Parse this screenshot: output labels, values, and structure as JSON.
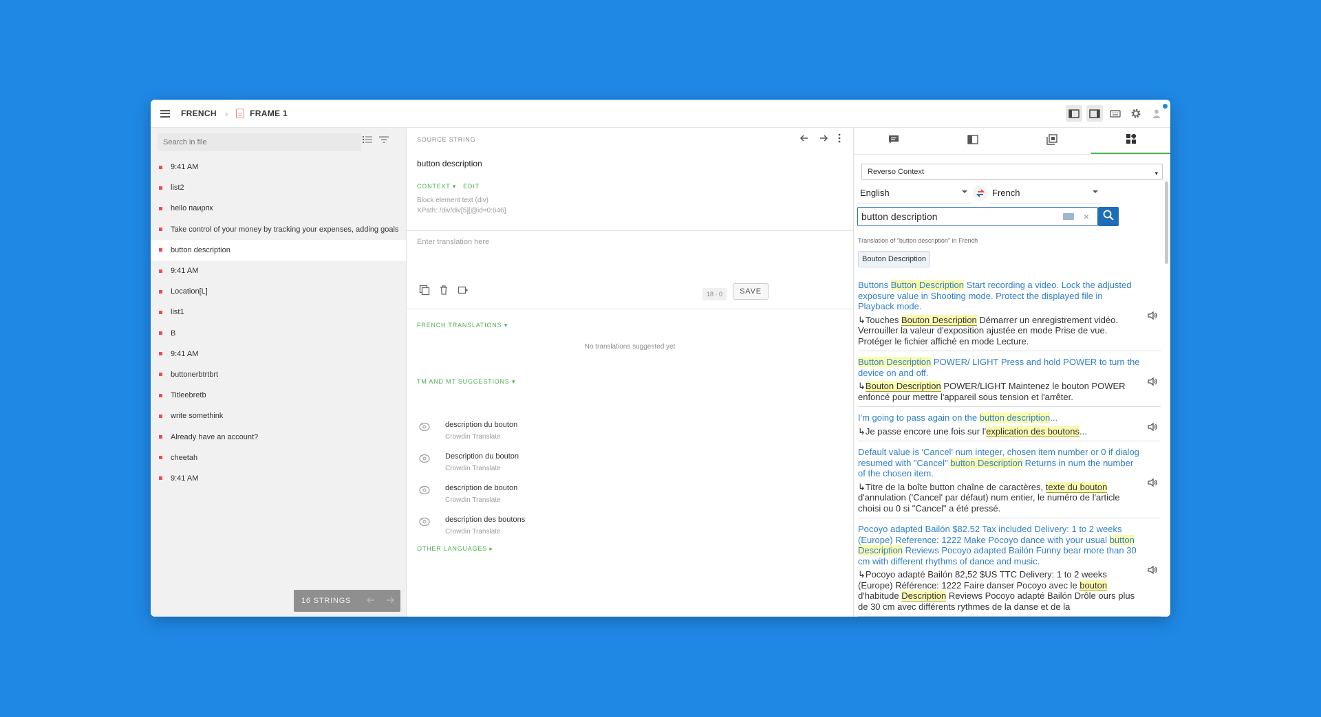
{
  "breadcrumb": {
    "project": "FRENCH",
    "file": "FRAME 1"
  },
  "toolbar": {
    "icons": [
      "sidebar-left-icon",
      "sidebar-right-icon",
      "keyboard-icon",
      "gear-icon",
      "user-icon"
    ]
  },
  "left_panel": {
    "search_placeholder": "Search in file",
    "strings": [
      "9:41 AM",
      "list2",
      "hello паирпк",
      "Take control of your money by tracking your expenses, adding goals",
      "button description",
      "9:41 AM",
      "Location[L]",
      "list1",
      "B",
      "9:41 AM",
      "buttonerbtrtbrt",
      "Titleebretb",
      "write somethink",
      "Already have an account?",
      "cheetah",
      "9:41 AM"
    ],
    "selected_index": 4,
    "count_label": "16 STRINGS"
  },
  "center_panel": {
    "source_label": "SOURCE STRING",
    "source_text": "button description",
    "context_label": "CONTEXT",
    "edit_label": "EDIT",
    "context_line1": "Block element text (div)",
    "context_line2": "XPath: /div/div[5][@id=0:646]",
    "translation_placeholder": "Enter translation here",
    "char_count": "18 · 0",
    "save_label": "SAVE",
    "french_translations_label": "FRENCH TRANSLATIONS",
    "no_translations": "No translations suggested yet",
    "tm_label": "TM AND MT SUGGESTIONS",
    "suggestions": [
      {
        "text": "description du bouton",
        "source": "Crowdin Translate"
      },
      {
        "text": "Description du bouton",
        "source": "Crowdin Translate"
      },
      {
        "text": "description de bouton",
        "source": "Crowdin Translate"
      },
      {
        "text": "description des boutons",
        "source": "Crowdin Translate"
      }
    ],
    "other_languages_label": "OTHER LANGUAGES"
  },
  "right_panel": {
    "tabs": [
      "comments-icon",
      "glossary-icon",
      "memory-icon",
      "apps-icon"
    ],
    "active_tab": 3,
    "provider": "Reverso Context",
    "source_lang": "English",
    "target_lang": "French",
    "query": "button description",
    "translation_of": "Translation of \"button description\" in French",
    "top_translation": "Bouton Description",
    "examples": [
      {
        "en": [
          "Buttons ",
          "Button Description",
          " Start recording a video. Lock the adjusted exposure value in Shooting mode. Protect the displayed file in Playback mode."
        ],
        "fr": [
          "↳Touches ",
          "Bouton Description",
          " Démarrer un enregistrement vidéo. Verrouiller la valeur d'exposition ajustée en mode Prise de vue. Protéger le fichier affiché en mode Lecture."
        ]
      },
      {
        "en": [
          "",
          "Button Description",
          " POWER/ LIGHT Press and hold POWER to turn the device on and off."
        ],
        "fr": [
          "↳",
          "Bouton Description",
          " POWER/LIGHT Maintenez le bouton POWER enfoncé pour mettre l'appareil sous tension et l'arrêter."
        ]
      },
      {
        "en": [
          "I'm going to pass again on the ",
          "button description",
          "..."
        ],
        "fr": [
          "↳Je passe encore une fois sur l'",
          "explication des boutons",
          "..."
        ]
      },
      {
        "en": [
          "Default value is 'Cancel' num integer, chosen item number or 0 if dialog resumed with \"Cancel\" ",
          "button Description",
          " Returns in num the number of the chosen item."
        ],
        "fr": [
          "↳Titre de la boîte button chaîne de caractères, ",
          "texte du bouton",
          " d'annulation ('Cancel' par défaut) num entier, le numéro de l'article choisi ou 0 si \"Cancel\" a été pressé."
        ]
      },
      {
        "en": [
          "Pocoyo adapted Bailón $82.52 Tax included Delivery: 1 to 2 weeks (Europe) Reference: 1222 Make Pocoyo dance with your usual ",
          "button Description",
          " Reviews Pocoyo adapted Bailón Funny bear more than 30 cm with different rhythms of dance and music."
        ],
        "fr": [
          "↳Pocoyo adapté Bailón 82,52 $US TTC Delivery: 1 to 2 weeks (Europe) Référence: 1222 Faire danser Pocoyo avec le ",
          "bouton",
          " d'habitude ",
          "Description",
          " Reviews Pocoyo adapté Bailón Drôle ours plus de 30 cm avec différents rythmes de la danse et de la"
        ]
      }
    ]
  }
}
